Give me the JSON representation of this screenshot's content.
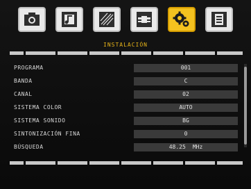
{
  "header": {
    "tabs": [
      {
        "icon": "picture-icon"
      },
      {
        "icon": "music-note-icon"
      },
      {
        "icon": "channel-scan-icon"
      },
      {
        "icon": "connection-icon"
      },
      {
        "icon": "settings-gears-icon",
        "active": true
      },
      {
        "icon": "document-icon"
      }
    ],
    "section_title": "INSTALACIÓN"
  },
  "menu": {
    "items": [
      {
        "label": "PROGRAMA",
        "value": "001"
      },
      {
        "label": "BANDA",
        "value": "C"
      },
      {
        "label": "CANAL",
        "value": "02"
      },
      {
        "label": "SISTEMA COLOR",
        "value": "AUTO"
      },
      {
        "label": "SISTEMA SONIDO",
        "value": "BG"
      },
      {
        "label": "SINTONIZACIÓN FINA",
        "value": "0"
      },
      {
        "label": "BÚSQUEDA",
        "value": "48.25",
        "unit": "MHz"
      }
    ]
  },
  "colors": {
    "accent": "#f4c21f",
    "title": "#e8b51a",
    "value_bg": "#3a3a3a"
  }
}
